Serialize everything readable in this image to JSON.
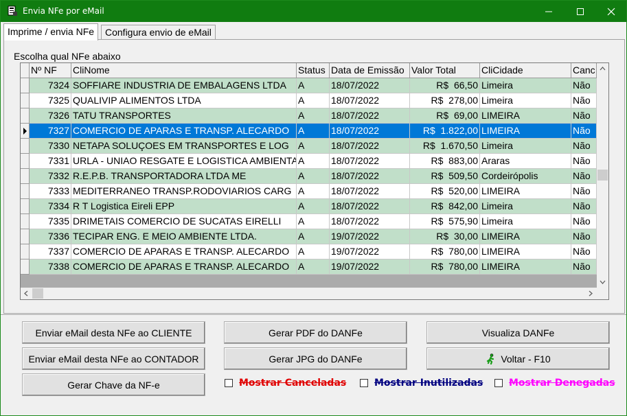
{
  "window": {
    "title": "Envia NFe por eMail"
  },
  "tabs": [
    {
      "label": "Imprime / envia NFe",
      "active": true
    },
    {
      "label": "Configura envio de eMail",
      "active": false
    }
  ],
  "label_choose": "Escolha qual NFe abaixo",
  "grid": {
    "columns": [
      "Nº NF",
      "CliNome",
      "Status",
      "Data de Emissão",
      "Valor Total",
      "CliCidade",
      "Canc"
    ],
    "selected_index": 3,
    "rows": [
      [
        "7324",
        "SOFFIARE INDUSTRIA DE EMBALAGENS LTDA",
        "A",
        "18/07/2022",
        "R$  66,50",
        "Limeira",
        "Não"
      ],
      [
        "7325",
        "QUALIVIP ALIMENTOS LTDA",
        "A",
        "18/07/2022",
        "R$  278,00",
        "Limeira",
        "Não"
      ],
      [
        "7326",
        "TATU TRANSPORTES",
        "A",
        "18/07/2022",
        "R$  69,00",
        "LIMEIRA",
        "Não"
      ],
      [
        "7327",
        "COMERCIO DE APARAS E TRANSP. ALECARDO",
        "A",
        "18/07/2022",
        "R$  1.822,00",
        "LIMEIRA",
        "Não"
      ],
      [
        "7330",
        "NETAPA SOLUÇOES EM TRANSPORTES E LOG",
        "A",
        "18/07/2022",
        "R$  1.670,50",
        "Limeira",
        "Não"
      ],
      [
        "7331",
        "URLA - UNIAO RESGATE E LOGISTICA AMBIENTA",
        "A",
        "18/07/2022",
        "R$  883,00",
        "Araras",
        "Não"
      ],
      [
        "7332",
        "R.E.P.B. TRANSPORTADORA LTDA ME",
        "A",
        "18/07/2022",
        "R$  509,50",
        "Cordeirópolis",
        "Não"
      ],
      [
        "7333",
        "MEDITERRANEO TRANSP.RODOVIARIOS CARG",
        "A",
        "18/07/2022",
        "R$  520,00",
        "LIMEIRA",
        "Não"
      ],
      [
        "7334",
        "R T Logistica Eireli EPP",
        "A",
        "18/07/2022",
        "R$  842,00",
        "Limeira",
        "Não"
      ],
      [
        "7335",
        "DRIMETAIS COMERCIO DE SUCATAS EIRELLI",
        "A",
        "18/07/2022",
        "R$  575,90",
        "Limeira",
        "Não"
      ],
      [
        "7336",
        "TECIPAR ENG. E MEIO AMBIENTE LTDA.",
        "A",
        "19/07/2022",
        "R$  30,00",
        "LIMEIRA",
        "Não"
      ],
      [
        "7337",
        "COMERCIO DE APARAS E TRANSP. ALECARDO",
        "A",
        "19/07/2022",
        "R$  780,00",
        "LIMEIRA",
        "Não"
      ],
      [
        "7338",
        "COMERCIO DE APARAS E TRANSP. ALECARDO",
        "A",
        "19/07/2022",
        "R$  780,00",
        "LIMEIRA",
        "Não"
      ]
    ]
  },
  "buttons": {
    "email_cliente": "Enviar eMail desta NFe ao CLIENTE",
    "email_contador": "Enviar eMail desta NFe ao CONTADOR",
    "gerar_chave": "Gerar Chave da NF-e",
    "gerar_pdf": "Gerar PDF do DANFe",
    "gerar_jpg": "Gerar JPG do DANFe",
    "visualiza": "Visualiza DANFe",
    "voltar": "Voltar - F10"
  },
  "checkboxes": {
    "canceladas": "Mostrar Canceladas",
    "inutilizadas": "Mostrar Inutilizadas",
    "denegadas": "Mostrar Denegadas"
  },
  "colors": {
    "titlebar": "#107c10",
    "row_alt": "#c1dfc9",
    "row_plain": "#ffffff",
    "selection": "#0078d7",
    "canceladas": "#e00000",
    "inutilizadas": "#000080",
    "denegadas": "#ff00ff"
  }
}
